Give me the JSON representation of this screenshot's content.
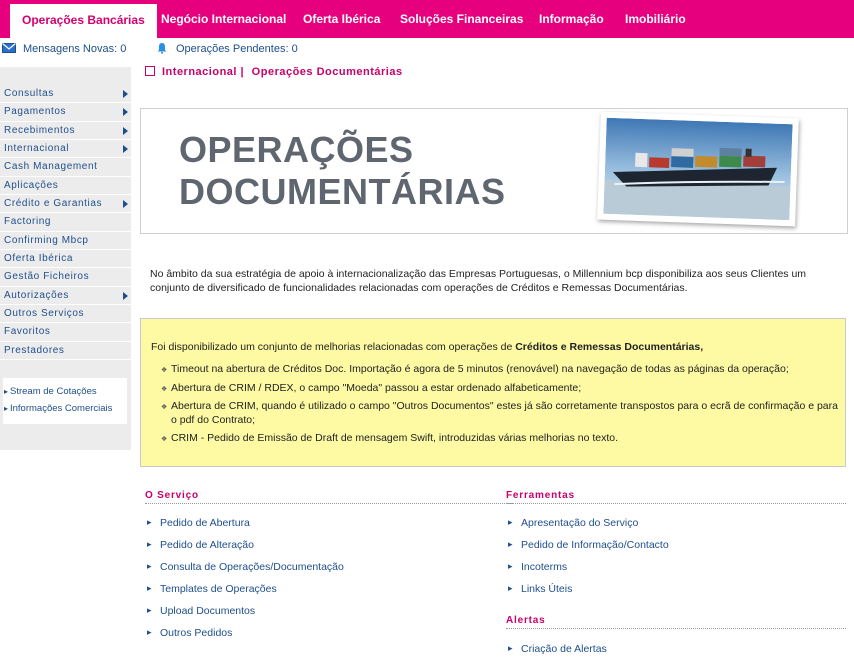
{
  "topnav": {
    "tabs": [
      "Operações Bancárias",
      "Negócio Internacional",
      "Oferta Ibérica",
      "Soluções Financeiras",
      "Informação",
      "Imobiliário"
    ]
  },
  "subbar": {
    "messages": "Mensagens Novas: 0",
    "pending": "Operações Pendentes: 0"
  },
  "sidebar": {
    "items": [
      {
        "label": "Consultas",
        "submenu": true
      },
      {
        "label": "Pagamentos",
        "submenu": true
      },
      {
        "label": "Recebimentos",
        "submenu": true
      },
      {
        "label": "Internacional",
        "submenu": true
      },
      {
        "label": "Cash Management",
        "submenu": false
      },
      {
        "label": "Aplicações",
        "submenu": false
      },
      {
        "label": "Crédito e Garantias",
        "submenu": true
      },
      {
        "label": "Factoring",
        "submenu": false
      },
      {
        "label": "Confirming Mbcp",
        "submenu": false
      },
      {
        "label": "Oferta Ibérica",
        "submenu": false
      },
      {
        "label": "Gestão Ficheiros",
        "submenu": false
      },
      {
        "label": "Autorizações",
        "submenu": true
      },
      {
        "label": "Outros Serviços",
        "submenu": false
      },
      {
        "label": "Favoritos",
        "submenu": false
      },
      {
        "label": "Prestadores",
        "submenu": false
      }
    ],
    "quick_links": [
      "Stream de Cotações",
      "Informações Comerciais"
    ]
  },
  "breadcrumb": {
    "section": "Internacional",
    "separator": "|",
    "page": "Operações Documentárias"
  },
  "banner": {
    "line1": "OPERAÇÕES",
    "line2": "DOCUMENTÁRIAS"
  },
  "intro": "No âmbito da sua estratégia de apoio à internacionalização das Empresas Portuguesas, o Millennium bcp disponibiliza aos seus Clientes um conjunto de diversificado de funcionalidades relacionadas com operações de Créditos e Remessas Documentárias.",
  "notice": {
    "text": "Foi disponibilizado um conjunto de melhorias relacionadas com operações de ",
    "strong": "Créditos e Remessas Documentárias,",
    "bullets": [
      "Timeout na abertura de Créditos Doc. Importação é agora de 5 minutos (renovável) na navegação de todas as páginas da operação;",
      "Abertura de CRIM / RDEX, o campo \"Moeda\" passou a estar ordenado alfabeticamente;",
      "Abertura de CRIM, quando é utilizado o campo \"Outros Documentos\" estes já são corretamente transpostos para o ecrã de confirmação e para o pdf do Contrato;",
      "CRIM - Pedido de Emissão de Draft de mensagem Swift, introduzidas várias melhorias no texto."
    ]
  },
  "servico": {
    "title": "O Serviço",
    "links": [
      "Pedido de Abertura",
      "Pedido de Alteração",
      "Consulta de Operações/Documentação",
      "Templates de Operações",
      "Upload Documentos",
      "Outros Pedidos"
    ]
  },
  "ferramentas": {
    "title": "Ferramentas",
    "links": [
      "Apresentação do Serviço",
      "Pedido de Informação/Contacto",
      "Incoterms",
      "Links Úteis"
    ]
  },
  "alertas": {
    "title": "Alertas",
    "links": [
      "Criação de Alertas"
    ]
  },
  "colors": {
    "brand": "#e6007e",
    "link": "#1f4e8c",
    "accent_text": "#c8006b",
    "notice_bg": "#fdfaa3"
  }
}
